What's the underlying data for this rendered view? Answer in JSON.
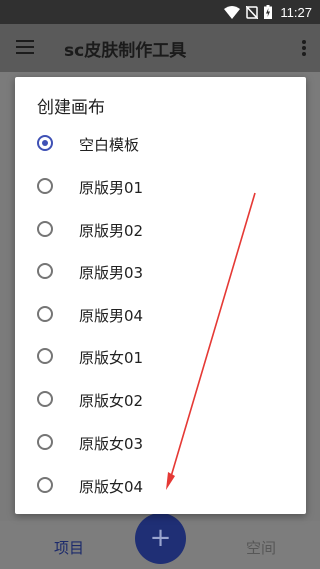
{
  "status_bar": {
    "time": "11:27"
  },
  "app_bar": {
    "title": "sc皮肤制作工具"
  },
  "dialog": {
    "title": "创建画布",
    "selected_index": 0,
    "options": [
      {
        "label": "空白模板"
      },
      {
        "label": "原版男01"
      },
      {
        "label": "原版男02"
      },
      {
        "label": "原版男03"
      },
      {
        "label": "原版男04"
      },
      {
        "label": "原版女01"
      },
      {
        "label": "原版女02"
      },
      {
        "label": "原版女03"
      },
      {
        "label": "原版女04"
      }
    ]
  },
  "bottom_nav": {
    "projects_label": "项目",
    "fab_label": "+",
    "space_label": "空间"
  },
  "colors": {
    "accent": "#3f51b5",
    "fab": "#1f2f75",
    "annotation_arrow": "#e53935"
  }
}
